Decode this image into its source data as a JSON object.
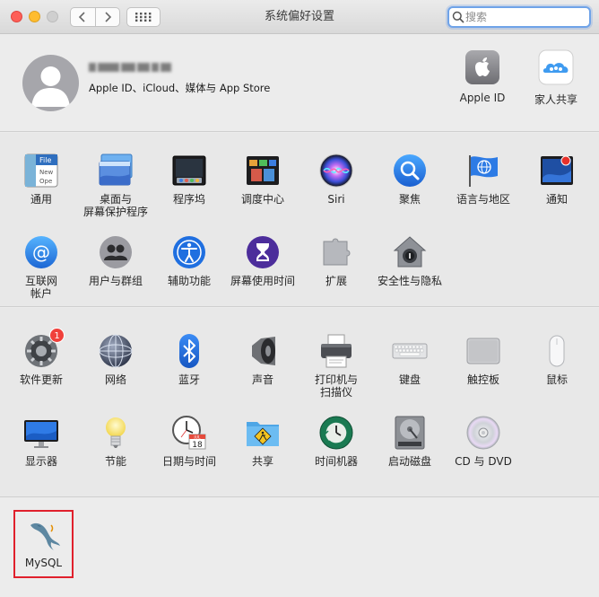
{
  "window": {
    "title": "系统偏好设置",
    "search_placeholder": "搜索"
  },
  "account": {
    "subtitle": "Apple ID、iCloud、媒体与 App Store",
    "apple_id_label": "Apple ID",
    "family_label": "家人共享"
  },
  "section1": {
    "items": [
      {
        "label": "通用",
        "icon": "general-icon"
      },
      {
        "label": "桌面与\n屏幕保护程序",
        "icon": "desktop-screensaver-icon"
      },
      {
        "label": "程序坞",
        "icon": "dock-icon"
      },
      {
        "label": "调度中心",
        "icon": "mission-control-icon"
      },
      {
        "label": "Siri",
        "icon": "siri-icon"
      },
      {
        "label": "聚焦",
        "icon": "spotlight-icon"
      },
      {
        "label": "语言与地区",
        "icon": "language-region-icon"
      },
      {
        "label": "通知",
        "icon": "notifications-icon"
      },
      {
        "label": "互联网\n帐户",
        "icon": "internet-accounts-icon"
      },
      {
        "label": "用户与群组",
        "icon": "users-groups-icon"
      },
      {
        "label": "辅助功能",
        "icon": "accessibility-icon"
      },
      {
        "label": "屏幕使用时间",
        "icon": "screen-time-icon"
      },
      {
        "label": "扩展",
        "icon": "extensions-icon"
      },
      {
        "label": "安全性与隐私",
        "icon": "security-privacy-icon"
      }
    ]
  },
  "section2": {
    "items": [
      {
        "label": "软件更新",
        "icon": "software-update-icon",
        "badge": "1"
      },
      {
        "label": "网络",
        "icon": "network-icon"
      },
      {
        "label": "蓝牙",
        "icon": "bluetooth-icon"
      },
      {
        "label": "声音",
        "icon": "sound-icon"
      },
      {
        "label": "打印机与\n扫描仪",
        "icon": "printer-scanner-icon"
      },
      {
        "label": "键盘",
        "icon": "keyboard-icon"
      },
      {
        "label": "触控板",
        "icon": "trackpad-icon"
      },
      {
        "label": "鼠标",
        "icon": "mouse-icon"
      },
      {
        "label": "显示器",
        "icon": "displays-icon"
      },
      {
        "label": "节能",
        "icon": "energy-saver-icon"
      },
      {
        "label": "日期与时间",
        "icon": "date-time-icon"
      },
      {
        "label": "共享",
        "icon": "sharing-icon"
      },
      {
        "label": "时间机器",
        "icon": "time-machine-icon"
      },
      {
        "label": "启动磁盘",
        "icon": "startup-disk-icon"
      },
      {
        "label": "CD 与 DVD",
        "icon": "cd-dvd-icon"
      }
    ]
  },
  "section3": {
    "items": [
      {
        "label": "MySQL",
        "icon": "mysql-icon"
      }
    ]
  },
  "icon_text": {
    "general_file": "File",
    "general_new": "New",
    "general_ope": "Ope",
    "calendar_month": "JUL",
    "calendar_day": "18"
  },
  "colors": {
    "highlight_border": "#e0202c",
    "badge": "#f0403b",
    "search_focus": "#6fa3e8"
  }
}
